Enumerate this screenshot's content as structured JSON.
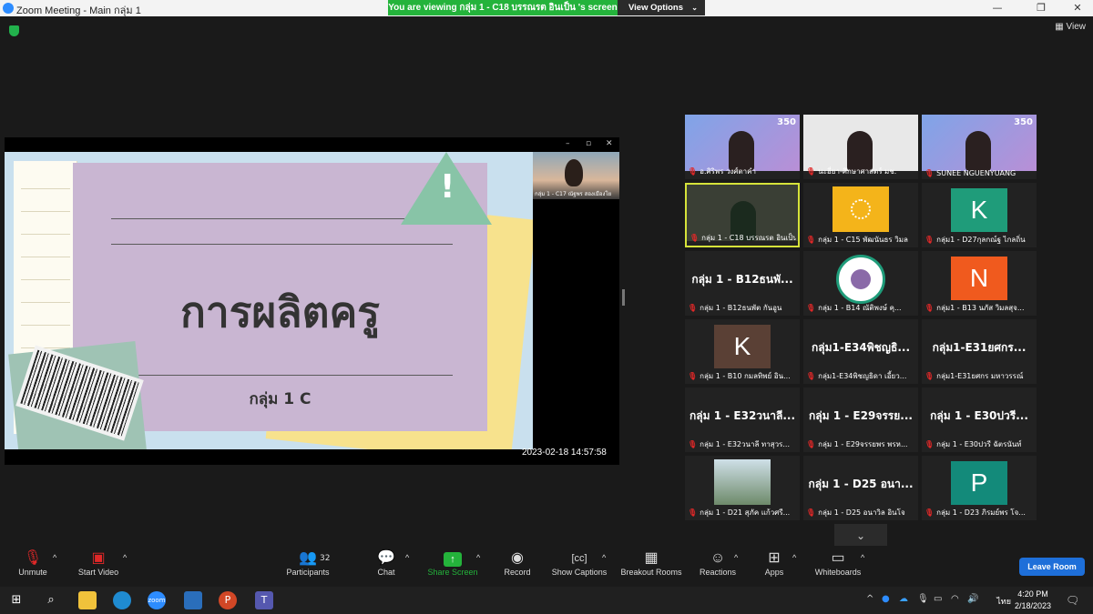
{
  "window": {
    "title": "Zoom Meeting - Main กลุ่ม 1"
  },
  "banner": {
    "text": "You are viewing กลุ่ม 1 - C18 บรรณรต อินเป็น 's screen",
    "view_options": "View Options"
  },
  "view_label": "View",
  "slide": {
    "title": "การผลิตครู",
    "subtitle": "กลุ่ม 1 C"
  },
  "timestamp": "2023-02-18  14:57:58",
  "presenter_thumb": {
    "name": "กลุ่ม 1 - C17 ณัฐพร สองเมืองโย"
  },
  "gallery": [
    {
      "label": "อ.ศิริพร วงศ์ตาคำ",
      "kind": "brand",
      "logo": "350"
    },
    {
      "label": "นะฮี่ยา-ศึกษาศาสตร์ มช.",
      "kind": "photo"
    },
    {
      "label": "SUNEE NGUENYUANG",
      "kind": "brand",
      "logo": "350"
    },
    {
      "label": "กลุ่ม 1 - C18 บรรณรต อินเป็น",
      "kind": "photo",
      "active": true
    },
    {
      "label": "กลุ่ม 1 - C15 พัฒนันธร วิมล",
      "kind": "sun"
    },
    {
      "label": "กลุ่ม1 - D27กุลกณ์ฐ ไกลถิ่น",
      "kind": "letter",
      "letter": "K",
      "bg": "#1f9c7a"
    },
    {
      "label": "กลุ่ม 1 - B12ธนพัต กันอูน",
      "kind": "name",
      "big": "กลุ่ม 1 - B12ธนพั..."
    },
    {
      "label": "กลุ่ม 1 - B14 ณัติพงษ์ คุ...",
      "kind": "seal"
    },
    {
      "label": "กลุ่ม1 - B13 นภัส วิมลสุจ...",
      "kind": "letter",
      "letter": "N",
      "bg": "#f05a1e"
    },
    {
      "label": "กลุ่ม 1 - B10 กมลทิพย์ อิน...",
      "kind": "letter",
      "letter": "K",
      "bg": "#5a4035"
    },
    {
      "label": "กลุ่ม1-E34พิชญธิดา เอี้ยว...",
      "kind": "name",
      "big": "กลุ่ม1-E34พิชญธิ..."
    },
    {
      "label": "กลุ่ม1-E31ยศกร มหาวรรณ์",
      "kind": "name",
      "big": "กลุ่ม1-E31ยศกร..."
    },
    {
      "label": "กลุ่ม 1 - E32วนาลี ทาสุวร...",
      "kind": "name",
      "big": "กลุ่ม 1 - E32วนาลี..."
    },
    {
      "label": "กลุ่ม 1 - E29จรรยพร พรห...",
      "kind": "name",
      "big": "กลุ่ม 1 - E29จรรย..."
    },
    {
      "label": "กลุ่ม 1 - E30ปวรี ฉัตรนันท์",
      "kind": "name",
      "big": "กลุ่ม 1 - E30ปวรี..."
    },
    {
      "label": "กลุ่ม 1 - D21 สุภัค แก้วศรี...",
      "kind": "photo2"
    },
    {
      "label": "กลุ่ม 1 - D25 อนาวิล อินโจ",
      "kind": "name",
      "big": "กลุ่ม 1 - D25 อนา..."
    },
    {
      "label": "กลุ่ม 1 - D23 ภิรมย์พร โจ...",
      "kind": "letter",
      "letter": "P",
      "bg": "#138a7a"
    }
  ],
  "toolbar": {
    "unmute": "Unmute",
    "start_video": "Start Video",
    "participants": "Participants",
    "participants_count": "32",
    "chat": "Chat",
    "share_screen": "Share Screen",
    "record": "Record",
    "show_captions": "Show Captions",
    "breakout_rooms": "Breakout Rooms",
    "reactions": "Reactions",
    "apps": "Apps",
    "whiteboards": "Whiteboards",
    "leave_room": "Leave Room"
  },
  "taskbar": {
    "time": "4:20 PM",
    "date": "2/18/2023",
    "lang": "ไทย"
  }
}
